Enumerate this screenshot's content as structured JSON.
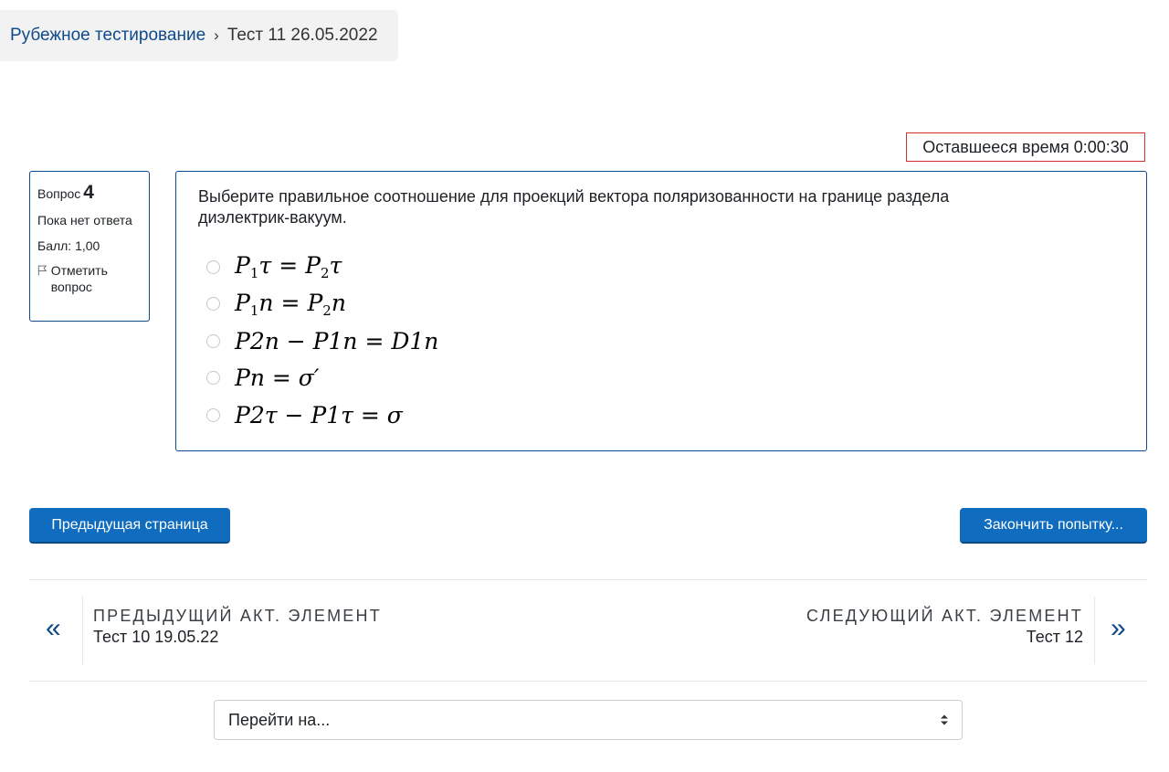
{
  "breadcrumb": {
    "parent": "Рубежное тестирование",
    "separator": "›",
    "current": "Тест 11 26.05.2022"
  },
  "timer": {
    "label": "Оставшееся время",
    "value": "0:00:30"
  },
  "question_info": {
    "question_label": "Вопрос",
    "question_number": "4",
    "state": "Пока нет ответа",
    "grade": "Балл: 1,00",
    "flag_label": "Отметить вопрос",
    "flag_icon": "flag-icon"
  },
  "question": {
    "text": "Выберите правильное соотношение для проекций вектора поляризованности на границе раздела диэлектрик-вакуум.",
    "answers": [
      {
        "lhs": [
          "P",
          "1",
          "τ"
        ],
        "op": "=",
        "rhs": [
          "P",
          "2",
          "τ"
        ]
      },
      {
        "lhs": [
          "P",
          "1",
          "n"
        ],
        "op": "=",
        "rhs": [
          "P",
          "2",
          "n"
        ]
      },
      {
        "formula": "P2n − P1n = D1n"
      },
      {
        "formula": "Pn = σ′"
      },
      {
        "formula": "P2τ − P1τ = σ"
      }
    ]
  },
  "buttons": {
    "prev_page": "Предыдущая страница",
    "finish": "Закончить попытку..."
  },
  "activity_nav": {
    "prev_label": "Предыдущий акт. элемент",
    "prev_title": "Тест 10 19.05.22",
    "prev_icon": "double-chevron-left-icon",
    "next_label": "Следующий акт. элемент",
    "next_title": "Тест 12",
    "next_icon": "double-chevron-right-icon"
  },
  "jump_select": {
    "selected": "Перейти на...",
    "icon": "select-caret-icon"
  },
  "colors": {
    "accent": "#0f6cbf",
    "link": "#0f4a8a",
    "timer_border": "#d32f2f"
  }
}
